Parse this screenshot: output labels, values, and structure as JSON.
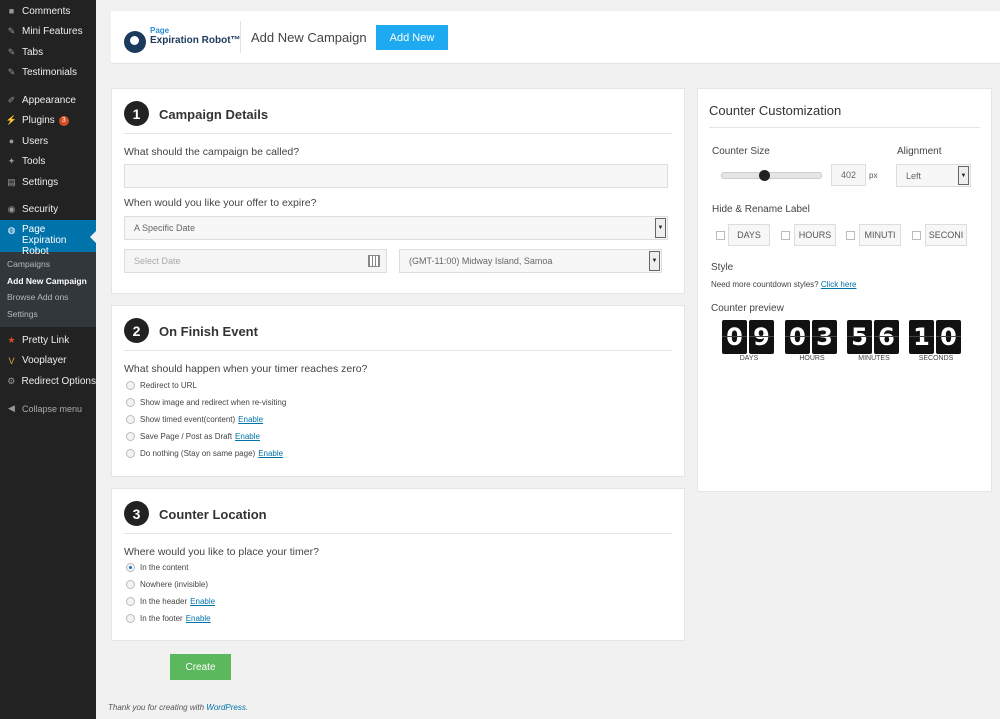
{
  "sidebar": {
    "items_top": [
      {
        "label": "Comments",
        "icon": "comment-icon"
      },
      {
        "label": "Mini Features",
        "icon": "pin-icon"
      },
      {
        "label": "Tabs",
        "icon": "pin-icon"
      },
      {
        "label": "Testimonials",
        "icon": "pin-icon"
      }
    ],
    "items_mid": [
      {
        "label": "Appearance",
        "icon": "brush-icon"
      },
      {
        "label": "Plugins",
        "icon": "plugin-icon",
        "badge": "3"
      },
      {
        "label": "Users",
        "icon": "users-icon"
      },
      {
        "label": "Tools",
        "icon": "wrench-icon"
      },
      {
        "label": "Settings",
        "icon": "sliders-icon"
      }
    ],
    "security": "Security",
    "active": "Page Expiration Robot",
    "submenu": [
      "Campaigns",
      "Add New Campaign",
      "Browse Add ons",
      "Settings"
    ],
    "items_bottom": [
      {
        "label": "Pretty Link",
        "icon": "star-icon"
      },
      {
        "label": "Vooplayer",
        "icon": "shield-icon"
      },
      {
        "label": "Redirect Options",
        "icon": "gear-icon"
      }
    ],
    "collapse": "Collapse menu"
  },
  "header": {
    "logo_line1": "Page",
    "logo_line2": "Expiration Robot™",
    "title": "Add New Campaign",
    "add_new": "Add New"
  },
  "campaign": {
    "step": "1",
    "title": "Campaign Details",
    "q_name": "What should the campaign be called?",
    "name_value": "",
    "q_expire": "When would you like your offer to expire?",
    "expire_option": "A Specific Date",
    "date_placeholder": "Select Date",
    "timezone": "(GMT-11:00) Midway Island, Samoa"
  },
  "finish": {
    "step": "2",
    "title": "On Finish Event",
    "question": "What should happen when your timer reaches zero?",
    "options": [
      {
        "label": "Redirect to URL",
        "link": ""
      },
      {
        "label": "Show image and redirect when re-visiting",
        "link": ""
      },
      {
        "label": "Show timed event(content)",
        "link": "Enable"
      },
      {
        "label": "Save Page / Post as Draft",
        "link": "Enable"
      },
      {
        "label": "Do nothing (Stay on same page)",
        "link": "Enable"
      }
    ]
  },
  "location": {
    "step": "3",
    "title": "Counter Location",
    "question": "Where would you like to place your timer?",
    "options": [
      {
        "label": "In the content",
        "link": "",
        "checked": true
      },
      {
        "label": "Nowhere (invisible)",
        "link": "",
        "checked": false
      },
      {
        "label": "In the header",
        "link": "Enable",
        "checked": false
      },
      {
        "label": "In the footer",
        "link": "Enable",
        "checked": false
      }
    ]
  },
  "create_label": "Create",
  "footer": {
    "text": "Thank you for creating with ",
    "link": "WordPress",
    "end": "."
  },
  "customization": {
    "title": "Counter Customization",
    "size_label": "Counter Size",
    "size_value": "402",
    "size_unit": "px",
    "alignment_label": "Alignment",
    "alignment_value": "Left",
    "rename_label": "Hide & Rename Label",
    "rename_fields": [
      "DAYS",
      "HOURS",
      "MINUTI",
      "SECONI"
    ],
    "style_label": "Style",
    "style_text": "Need more countdown styles?",
    "style_link": "Click here",
    "preview_label": "Counter preview",
    "preview": {
      "days": "09",
      "hours": "03",
      "minutes": "56",
      "seconds": "10",
      "units": [
        "DAYS",
        "HOURS",
        "MINUTES",
        "SECONDS"
      ]
    }
  },
  "colors": {
    "accent": "#0073aa",
    "add_new": "#1eaaf1",
    "create": "#5cb85c"
  }
}
